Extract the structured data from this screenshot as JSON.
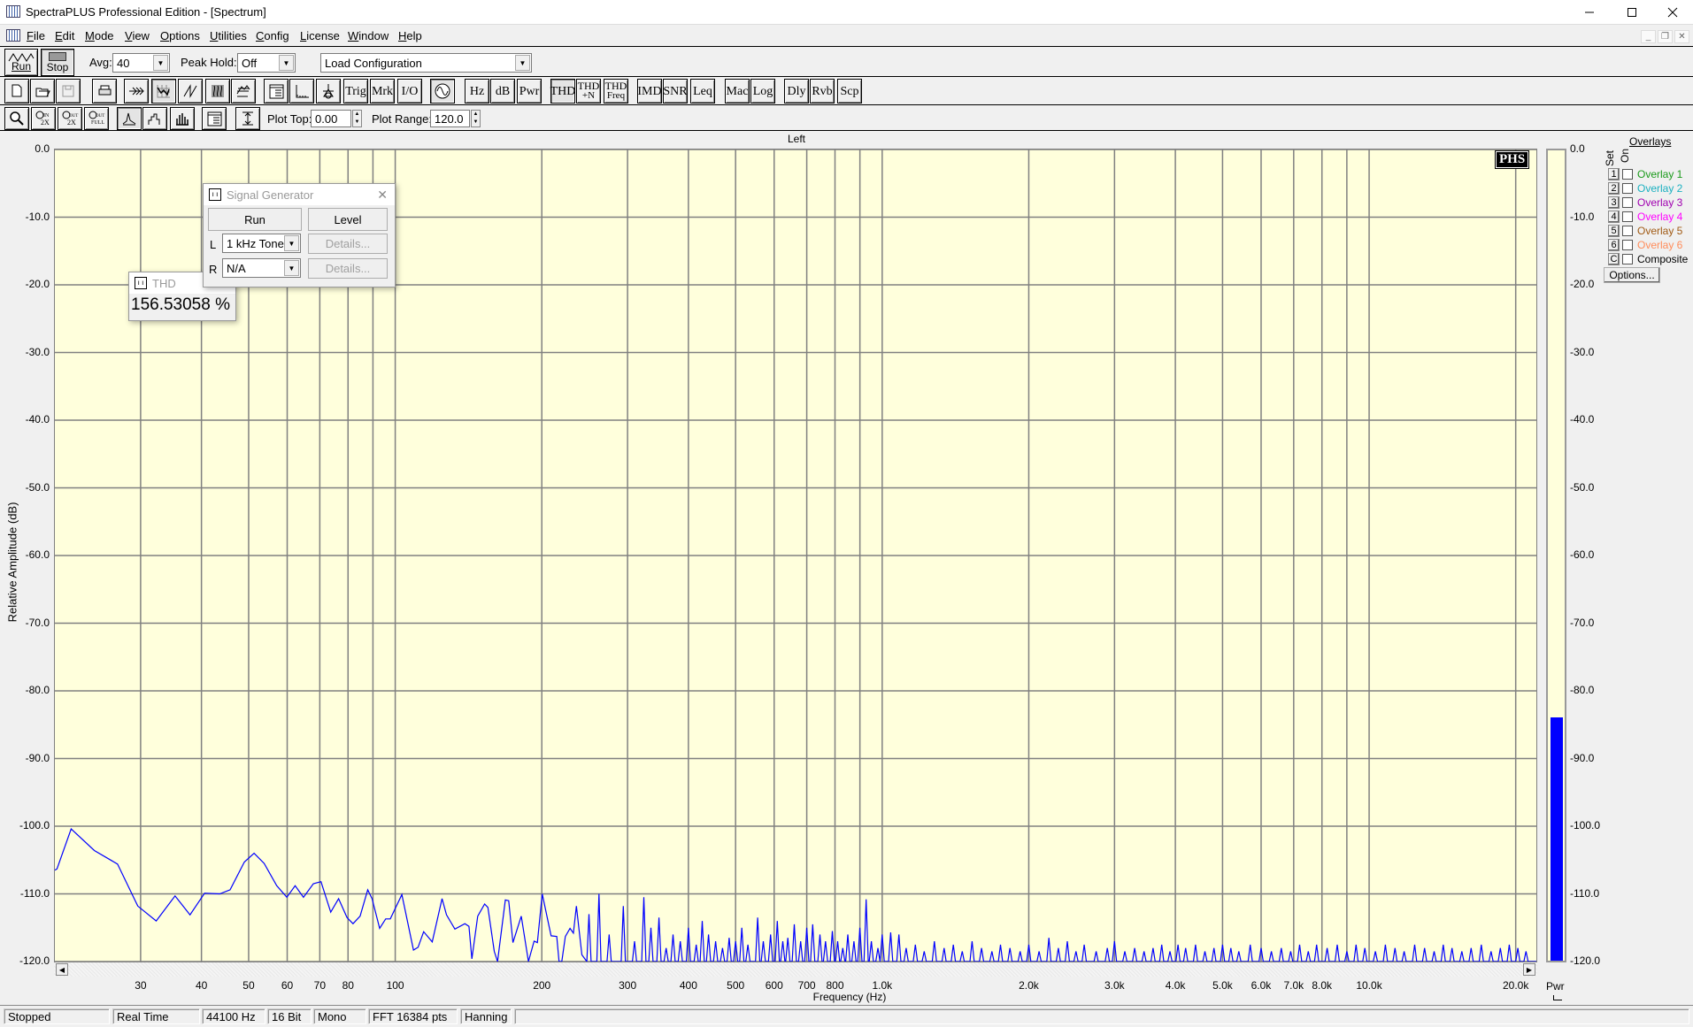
{
  "window": {
    "title": "SpectraPLUS Professional Edition - [Spectrum]"
  },
  "menu": [
    "File",
    "Edit",
    "Mode",
    "View",
    "Options",
    "Utilities",
    "Config",
    "License",
    "Window",
    "Help"
  ],
  "toolbar1": {
    "run_label": "Run",
    "stop_label": "Stop",
    "avg_label": "Avg:",
    "avg_value": "40",
    "peak_hold_label": "Peak Hold:",
    "peak_hold_value": "Off",
    "config_value": "Load Configuration"
  },
  "toolbar2": {
    "buttons": [
      {
        "icon": "new-file"
      },
      {
        "icon": "open-folder"
      },
      {
        "icon": "save-disk",
        "disabled": true
      },
      {
        "icon": "print"
      },
      {
        "icon": "fast-forward-arrows"
      },
      {
        "icon": "spectrum-plot",
        "pressed": true
      },
      {
        "icon": "time-series"
      },
      {
        "icon": "spectrogram"
      },
      {
        "icon": "3d-surface"
      },
      {
        "icon": "settings-panel"
      },
      {
        "icon": "axis-scale"
      },
      {
        "icon": "calibration"
      },
      {
        "label": "Trig"
      },
      {
        "label": "Mrk"
      },
      {
        "label": "I/O"
      },
      {
        "icon": "signal-generator",
        "pressed": true
      },
      {
        "label": "Hz"
      },
      {
        "label": "dB"
      },
      {
        "label": "Pwr"
      },
      {
        "label": "THD",
        "pressed": true
      },
      {
        "label": "THD",
        "label2": "+N"
      },
      {
        "label": "THD",
        "label2": "Freq"
      },
      {
        "label": "IMD"
      },
      {
        "label": "SNR"
      },
      {
        "label": "Leq"
      },
      {
        "label": "Mac"
      },
      {
        "label": "Log"
      },
      {
        "label": "Dly"
      },
      {
        "label": "Rvb"
      },
      {
        "label": "Scp"
      }
    ]
  },
  "toolbar3": {
    "buttons": [
      {
        "icon": "zoom"
      },
      {
        "icon": "zoom-in-2x",
        "text": "IN 2X"
      },
      {
        "icon": "zoom-out-2x",
        "text": "OUT 2X"
      },
      {
        "icon": "zoom-out-full",
        "text": "OUT FULL"
      },
      {
        "icon": "line-plot",
        "pressed": true
      },
      {
        "icon": "step-plot"
      },
      {
        "icon": "bar-plot"
      },
      {
        "icon": "plot-properties"
      },
      {
        "icon": "autoscale"
      }
    ],
    "plot_top_label": "Plot Top:",
    "plot_top_value": "0.00",
    "plot_range_label": "Plot Range:",
    "plot_range_value": "120.0"
  },
  "plot": {
    "channel_title": "Left",
    "logo": "PHS",
    "trace_color": "#0000ff",
    "background": "#ffffdc"
  },
  "chart_data": {
    "type": "line",
    "title": "Left",
    "xlabel": "Frequency (Hz)",
    "ylabel": "Relative Amplitude (dB)",
    "xscale": "log",
    "xlim": [
      20,
      22050
    ],
    "ylim": [
      -120,
      0
    ],
    "grid": true,
    "yticks": [
      "0.0",
      "-10.0",
      "-20.0",
      "-30.0",
      "-40.0",
      "-50.0",
      "-60.0",
      "-70.0",
      "-80.0",
      "-90.0",
      "-100.0",
      "-110.0",
      "-120.0"
    ],
    "ytick_values": [
      0,
      -10,
      -20,
      -30,
      -40,
      -50,
      -60,
      -70,
      -80,
      -90,
      -100,
      -110,
      -120
    ],
    "xgrid": [
      30,
      40,
      50,
      60,
      70,
      80,
      90,
      100,
      200,
      300,
      400,
      500,
      600,
      700,
      800,
      900,
      1000,
      2000,
      3000,
      4000,
      5000,
      6000,
      7000,
      8000,
      9000,
      10000,
      20000
    ],
    "xticks": [
      {
        "f": 30,
        "label": "30"
      },
      {
        "f": 40,
        "label": "40"
      },
      {
        "f": 50,
        "label": "50"
      },
      {
        "f": 60,
        "label": "60"
      },
      {
        "f": 70,
        "label": "70"
      },
      {
        "f": 80,
        "label": "80"
      },
      {
        "f": 100,
        "label": "100"
      },
      {
        "f": 200,
        "label": "200"
      },
      {
        "f": 300,
        "label": "300"
      },
      {
        "f": 400,
        "label": "400"
      },
      {
        "f": 500,
        "label": "500"
      },
      {
        "f": 600,
        "label": "600"
      },
      {
        "f": 700,
        "label": "700"
      },
      {
        "f": 800,
        "label": "800"
      },
      {
        "f": 1000,
        "label": "1.0k"
      },
      {
        "f": 2000,
        "label": "2.0k"
      },
      {
        "f": 3000,
        "label": "3.0k"
      },
      {
        "f": 4000,
        "label": "4.0k"
      },
      {
        "f": 5000,
        "label": "5.0k"
      },
      {
        "f": 6000,
        "label": "6.0k"
      },
      {
        "f": 7000,
        "label": "7.0k"
      },
      {
        "f": 8000,
        "label": "8.0k"
      },
      {
        "f": 10000,
        "label": "10.0k"
      },
      {
        "f": 20000,
        "label": "20.0k"
      }
    ],
    "series": [
      {
        "name": "Left",
        "points": [
          [
            20,
            -106.5
          ],
          [
            20.2,
            -106.3
          ],
          [
            21.6,
            -100.4
          ],
          [
            24.1,
            -103.6
          ],
          [
            26.9,
            -105.6
          ],
          [
            29.6,
            -111.8
          ],
          [
            32.3,
            -114
          ],
          [
            35.3,
            -110.3
          ],
          [
            37.9,
            -113.1
          ],
          [
            40.6,
            -109.9
          ],
          [
            43.6,
            -110
          ],
          [
            45.8,
            -109.4
          ],
          [
            49,
            -105.3
          ],
          [
            51.3,
            -104
          ],
          [
            53.8,
            -105.5
          ],
          [
            57.1,
            -108.8
          ],
          [
            59.9,
            -110.5
          ],
          [
            62.3,
            -108.8
          ],
          [
            64.8,
            -110.5
          ],
          [
            67.9,
            -108.5
          ],
          [
            70.4,
            -108.2
          ],
          [
            73.7,
            -112.7
          ],
          [
            76.5,
            -110.7
          ],
          [
            79.6,
            -113.5
          ],
          [
            81.9,
            -114.4
          ],
          [
            84.7,
            -113.3
          ],
          [
            87.8,
            -109.4
          ],
          [
            89.6,
            -110.7
          ],
          [
            92.9,
            -115.1
          ],
          [
            95.6,
            -113.7
          ],
          [
            97.7,
            -113.7
          ],
          [
            103.2,
            -110.1
          ],
          [
            109,
            -118.3
          ],
          [
            111.4,
            -117.9
          ],
          [
            114.4,
            -115.6
          ],
          [
            119.1,
            -117.1
          ],
          [
            124.8,
            -110.7
          ],
          [
            127.4,
            -113.1
          ],
          [
            132.6,
            -115.2
          ],
          [
            139,
            -114.4
          ],
          [
            141.7,
            -114.8
          ],
          [
            143.7,
            -119.6
          ],
          [
            147.7,
            -113.3
          ],
          [
            152.6,
            -111.5
          ],
          [
            155,
            -112
          ],
          [
            159.7,
            -118.5
          ],
          [
            162.2,
            -120
          ],
          [
            168.3,
            -110.9
          ],
          [
            171,
            -111
          ],
          [
            174.5,
            -117.2
          ],
          [
            181.5,
            -113.3
          ],
          [
            187.7,
            -120
          ],
          [
            192.8,
            -117
          ],
          [
            195.8,
            -117.2
          ],
          [
            200.4,
            -110
          ],
          [
            209,
            -116.2
          ],
          [
            214.6,
            -116.3
          ],
          [
            217,
            -120
          ],
          [
            219.8,
            -120
          ],
          [
            223.5,
            -116.3
          ],
          [
            228.5,
            -115.1
          ],
          [
            232.2,
            -115.8
          ],
          [
            235.5,
            -111.8
          ],
          [
            241.7,
            -119
          ]
        ],
        "peaks": [
          [
            250,
            -113
          ],
          [
            262,
            -110
          ],
          [
            275,
            -116
          ],
          [
            294,
            -111.8
          ],
          [
            310,
            -117
          ],
          [
            324,
            -110.5
          ],
          [
            335,
            -115
          ],
          [
            348,
            -113.5
          ],
          [
            360,
            -118
          ],
          [
            372,
            -116
          ],
          [
            385,
            -117
          ],
          [
            400,
            -115
          ],
          [
            415,
            -117.5
          ],
          [
            427,
            -114
          ],
          [
            440,
            -116
          ],
          [
            455,
            -117
          ],
          [
            470,
            -118
          ],
          [
            485,
            -116.5
          ],
          [
            500,
            -117
          ],
          [
            515,
            -115
          ],
          [
            530,
            -117.5
          ],
          [
            555,
            -113.5
          ],
          [
            570,
            -117
          ],
          [
            590,
            -116
          ],
          [
            609,
            -114
          ],
          [
            625,
            -117
          ],
          [
            640,
            -116.5
          ],
          [
            660,
            -114.5
          ],
          [
            680,
            -117
          ],
          [
            700,
            -115
          ],
          [
            720,
            -114.5
          ],
          [
            745,
            -116
          ],
          [
            765,
            -117
          ],
          [
            790,
            -115.5
          ],
          [
            810,
            -117
          ],
          [
            830,
            -118
          ],
          [
            850,
            -116
          ],
          [
            875,
            -117
          ],
          [
            900,
            -115
          ],
          [
            927,
            -110.8
          ],
          [
            950,
            -117
          ],
          [
            980,
            -118
          ],
          [
            1000,
            -116
          ],
          [
            1041,
            -115.7
          ],
          [
            1082,
            -116
          ],
          [
            1120,
            -118
          ],
          [
            1170,
            -117.5
          ],
          [
            1220,
            -118.5
          ],
          [
            1280,
            -117
          ],
          [
            1340,
            -118
          ],
          [
            1400,
            -117.5
          ],
          [
            1460,
            -118.5
          ],
          [
            1530,
            -117
          ],
          [
            1600,
            -118
          ],
          [
            1680,
            -118.5
          ],
          [
            1750,
            -117.5
          ],
          [
            1830,
            -118
          ],
          [
            1920,
            -118.5
          ],
          [
            2000,
            -117.5
          ],
          [
            2100,
            -118.5
          ],
          [
            2200,
            -116.5
          ],
          [
            2300,
            -118
          ],
          [
            2400,
            -117
          ],
          [
            2500,
            -118.5
          ],
          [
            2600,
            -117.5
          ],
          [
            2750,
            -118.5
          ],
          [
            2900,
            -118
          ],
          [
            3000,
            -117
          ],
          [
            3150,
            -118.5
          ],
          [
            3300,
            -118
          ],
          [
            3450,
            -118.5
          ],
          [
            3600,
            -118
          ],
          [
            3750,
            -117.5
          ],
          [
            3900,
            -118.5
          ],
          [
            4050,
            -117.5
          ],
          [
            4200,
            -118
          ],
          [
            4400,
            -117.5
          ],
          [
            4600,
            -118.5
          ],
          [
            4800,
            -118
          ],
          [
            5000,
            -117.5
          ],
          [
            5200,
            -118
          ],
          [
            5400,
            -118.5
          ],
          [
            5700,
            -117.5
          ],
          [
            6000,
            -118
          ],
          [
            6300,
            -118.5
          ],
          [
            6600,
            -118
          ],
          [
            6900,
            -118.5
          ],
          [
            7200,
            -117.5
          ],
          [
            7500,
            -118.5
          ],
          [
            7800,
            -117.5
          ],
          [
            8200,
            -118
          ],
          [
            8600,
            -117.5
          ],
          [
            9000,
            -118.5
          ],
          [
            9400,
            -117.5
          ],
          [
            9800,
            -118
          ],
          [
            10300,
            -118.5
          ],
          [
            10800,
            -117.5
          ],
          [
            11300,
            -118
          ],
          [
            11800,
            -118.5
          ],
          [
            12400,
            -117.5
          ],
          [
            13000,
            -118
          ],
          [
            13600,
            -118.5
          ],
          [
            14200,
            -117.5
          ],
          [
            14800,
            -118
          ],
          [
            15500,
            -118.5
          ],
          [
            16200,
            -118
          ],
          [
            17000,
            -117.5
          ],
          [
            17800,
            -118.5
          ],
          [
            18600,
            -118
          ],
          [
            19400,
            -117.5
          ],
          [
            20200,
            -118
          ],
          [
            21000,
            -118.5
          ]
        ]
      }
    ]
  },
  "power_meter": {
    "label": "Pwr",
    "level_db": -84,
    "color": "#0000ff"
  },
  "overlays": {
    "title": "Overlays",
    "set_label": "Set",
    "on_label": "On",
    "options_label": "Options...",
    "items": [
      {
        "set": "1",
        "label": "Overlay 1",
        "color": "#1a9a1a",
        "checked": false
      },
      {
        "set": "2",
        "label": "Overlay 2",
        "color": "#1ab0c0",
        "checked": false
      },
      {
        "set": "3",
        "label": "Overlay 3",
        "color": "#a000b0",
        "checked": false
      },
      {
        "set": "4",
        "label": "Overlay 4",
        "color": "#ff00ff",
        "checked": false
      },
      {
        "set": "5",
        "label": "Overlay 5",
        "color": "#a05a14",
        "checked": false
      },
      {
        "set": "6",
        "label": "Overlay 6",
        "color": "#ff8c5a",
        "checked": false
      },
      {
        "set": "C",
        "label": "Composite",
        "color": "#000000",
        "checked": false
      }
    ]
  },
  "signal_generator": {
    "title": "Signal Generator",
    "run_label": "Run",
    "level_label": "Level",
    "left_label": "L",
    "left_value": "1 kHz Tone",
    "right_label": "R",
    "right_value": "N/A",
    "details_label": "Details..."
  },
  "thd_window": {
    "title": "THD",
    "value": "156.53058 %"
  },
  "status_bar": [
    "Stopped",
    "Real Time",
    "44100 Hz",
    "16 Bit",
    "Mono",
    "FFT 16384 pts",
    "Hanning",
    ""
  ]
}
